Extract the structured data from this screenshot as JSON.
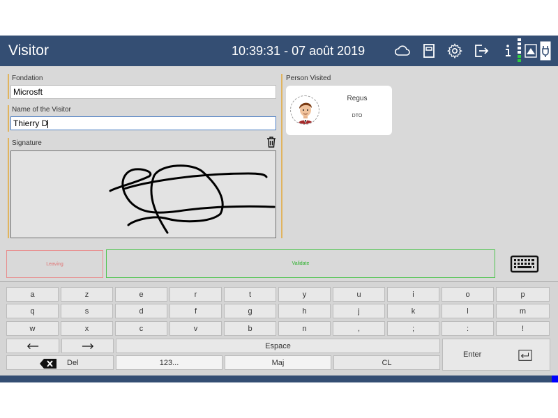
{
  "header": {
    "title": "Visitor",
    "datetime": "10:39:31 - 07 août 2019",
    "icons": [
      "cloud-icon",
      "document-icon",
      "gear-icon",
      "logout-icon",
      "info-icon",
      "signal-icon",
      "network-icon",
      "power-plug-icon"
    ]
  },
  "form": {
    "foundation_label": "Fondation",
    "foundation_value": "Microsft",
    "visitor_label": "Name of the Visitor",
    "visitor_value": "Thierry D",
    "signature_label": "Signature"
  },
  "person_visited": {
    "label": "Person Visited",
    "name": "Regus",
    "role": "DTO"
  },
  "actions": {
    "leaving_label": "Leaving",
    "validate_label": "Validate"
  },
  "keyboard": {
    "rows": [
      [
        "a",
        "z",
        "e",
        "r",
        "t",
        "y",
        "u",
        "i",
        "o",
        "p"
      ],
      [
        "q",
        "s",
        "d",
        "f",
        "g",
        "h",
        "j",
        "k",
        "l",
        "m"
      ],
      [
        "w",
        "x",
        "c",
        "v",
        "b",
        "n",
        ",",
        ";",
        ":",
        "!"
      ]
    ],
    "space_label": "Espace",
    "del_label": "Del",
    "numbers_label": "123...",
    "shift_label": "Maj",
    "caps_label": "CL",
    "enter_label": "Enter"
  },
  "colors": {
    "header_bg": "#344e73",
    "leaving": "#e07070",
    "validate": "#2bb02b",
    "accent_bar": "#e1b45e"
  }
}
